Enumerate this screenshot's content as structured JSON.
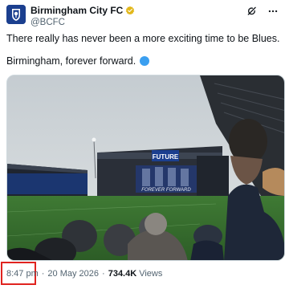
{
  "author": {
    "name": "Birmingham City FC",
    "handle": "@BCFC"
  },
  "tweet": {
    "line1": "There really has never been a more exciting time to be Blues.",
    "line2": "Birmingham, forever forward."
  },
  "media": {
    "stand_banner_text": "FUTURE",
    "tifo_text": "FOREVER FORWARD"
  },
  "meta": {
    "time": "8:47 pm",
    "separator1": "·",
    "date": "20 May 2026",
    "separator2": "·",
    "views_count": "734.4K",
    "views_label": "Views"
  },
  "icons": {
    "verified": "verified-badge-icon",
    "grok": "grok-icon",
    "more": "more-icon",
    "emoji": "blue-circle-emoji"
  },
  "colors": {
    "brand_blue": "#1b3f8f",
    "verified_gold": "#e2b719",
    "highlight_red": "#e0231f",
    "secondary_text": "#536471"
  }
}
